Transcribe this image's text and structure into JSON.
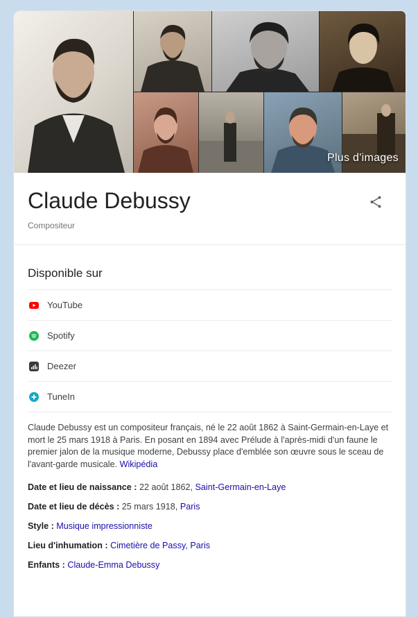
{
  "gallery": {
    "more_images_label": "Plus d'images"
  },
  "header": {
    "name": "Claude Debussy",
    "subtitle": "Compositeur",
    "share_icon": "share-icon"
  },
  "available": {
    "title": "Disponible sur",
    "services": [
      {
        "label": "YouTube",
        "icon": "youtube-icon",
        "color": "#ff0000"
      },
      {
        "label": "Spotify",
        "icon": "spotify-icon",
        "color": "#1db954"
      },
      {
        "label": "Deezer",
        "icon": "deezer-icon",
        "color": "#3a3a3a"
      },
      {
        "label": "TuneIn",
        "icon": "tunein-icon",
        "color": "#14a8c4"
      }
    ]
  },
  "description": {
    "text": "Claude Debussy est un compositeur français, né le 22 août 1862 à Saint-Germain-en-Laye et mort le 25 mars 1918 à Paris. En posant en 1894 avec Prélude à l'après-midi d'un faune le premier jalon de la musique moderne, Debussy place d'emblée son œuvre sous le sceau de l'avant-garde musicale.",
    "source": "Wikipédia"
  },
  "facts": [
    {
      "label": "Date et lieu de naissance :",
      "value": "22 août 1862,",
      "link": "Saint-Germain-en-Laye"
    },
    {
      "label": "Date et lieu de décès :",
      "value": "25 mars 1918,",
      "link": "Paris"
    },
    {
      "label": "Style :",
      "value": "",
      "link": "Musique impressionniste"
    },
    {
      "label": "Lieu d'inhumation :",
      "value": "",
      "link": "Cimetière de Passy, Paris"
    },
    {
      "label": "Enfants :",
      "value": "",
      "link": "Claude-Emma Debussy"
    }
  ],
  "colors": {
    "link": "#1a0dab",
    "text": "#202124",
    "muted": "#70757a",
    "page_bg": "#c9dcee"
  }
}
